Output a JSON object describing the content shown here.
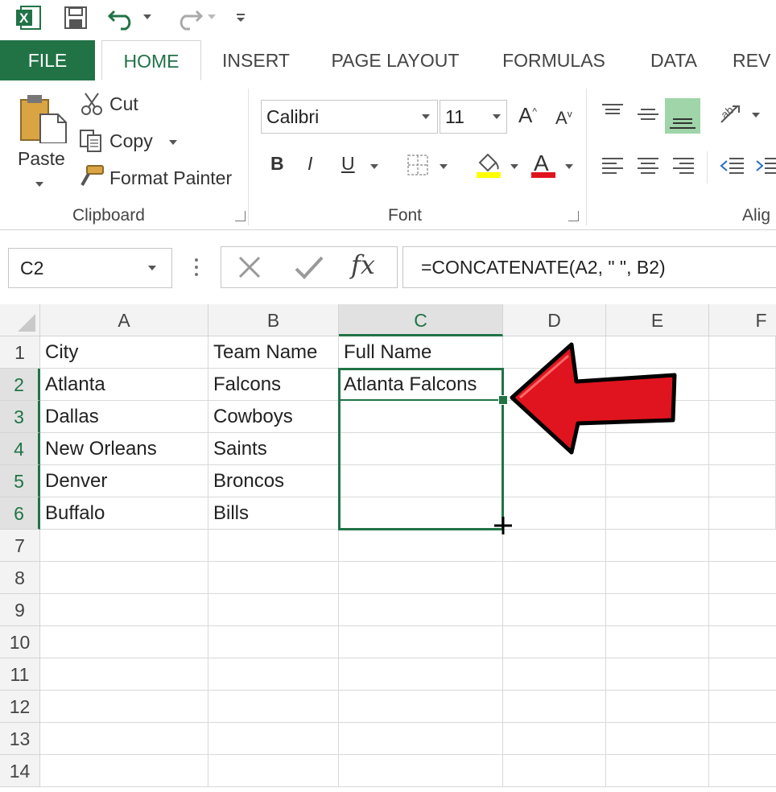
{
  "quick_access": {
    "app_icon": "excel-icon",
    "app_letter": "X",
    "save_icon": "save-icon",
    "undo_icon": "undo-icon",
    "redo_icon": "redo-icon",
    "customize_icon": "customize-qat-icon"
  },
  "tabs": [
    {
      "label": "FILE"
    },
    {
      "label": "HOME"
    },
    {
      "label": "INSERT"
    },
    {
      "label": "PAGE LAYOUT"
    },
    {
      "label": "FORMULAS"
    },
    {
      "label": "DATA"
    },
    {
      "label": "REV"
    }
  ],
  "ribbon": {
    "clipboard": {
      "paste_label": "Paste",
      "cut_label": "Cut",
      "copy_label": "Copy",
      "format_painter_label": "Format Painter",
      "group_label": "Clipboard"
    },
    "font": {
      "font_name": "Calibri",
      "font_size": "11",
      "bold": "B",
      "italic": "I",
      "underline": "U",
      "font_color_letter": "A",
      "grow_letter": "A",
      "shrink_letter": "A",
      "group_label": "Font"
    },
    "alignment": {
      "group_label": "Alig"
    }
  },
  "formula_bar": {
    "name_box": "C2",
    "fx_label": "fx",
    "formula": "=CONCATENATE(A2, \" \", B2)"
  },
  "sheet": {
    "columns": [
      "A",
      "B",
      "C",
      "D",
      "E",
      "F"
    ],
    "rows": [
      "1",
      "2",
      "3",
      "4",
      "5",
      "6",
      "7",
      "8",
      "9",
      "10",
      "11",
      "12",
      "13",
      "14"
    ],
    "cells": {
      "A1": "City",
      "B1": "Team Name",
      "C1": "Full Name",
      "A2": "Atlanta",
      "B2": "Falcons",
      "C2": "Atlanta Falcons",
      "A3": "Dallas",
      "B3": "Cowboys",
      "A4": "New Orleans",
      "B4": "Saints",
      "A5": "Denver",
      "B5": "Broncos",
      "A6": "Buffalo",
      "B6": "Bills"
    },
    "active_cell": "C2",
    "selection": "C2:C6"
  },
  "colors": {
    "excel_green": "#217346",
    "arrow_red": "#e0141e"
  }
}
